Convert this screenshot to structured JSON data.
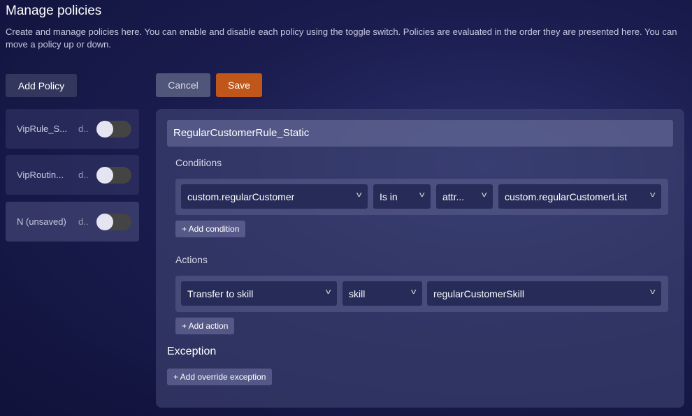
{
  "header": {
    "title": "Manage policies",
    "description": "Create and manage policies here. You can enable and disable each policy using the toggle switch. Policies are evaluated in the order they are presented here. You can move a policy up or down."
  },
  "toolbar": {
    "add_policy": "Add Policy",
    "cancel": "Cancel",
    "save": "Save"
  },
  "policies": [
    {
      "name": "VipRule_S...",
      "desc": "d..",
      "enabled": false
    },
    {
      "name": "VipRoutin...",
      "desc": "d..",
      "enabled": false
    },
    {
      "name": "N (unsaved)",
      "desc": "d..",
      "enabled": false
    }
  ],
  "editor": {
    "name": "RegularCustomerRule_Static",
    "conditions_label": "Conditions",
    "condition": {
      "field": "custom.regularCustomer",
      "operator": "Is in",
      "type": "attr...",
      "value": "custom.regularCustomerList"
    },
    "add_condition": "+ Add condition",
    "actions_label": "Actions",
    "action": {
      "type": "Transfer to skill",
      "target_type": "skill",
      "value": "regularCustomerSkill"
    },
    "add_action": "+ Add action",
    "exception_label": "Exception",
    "add_exception": "+ Add override exception"
  }
}
